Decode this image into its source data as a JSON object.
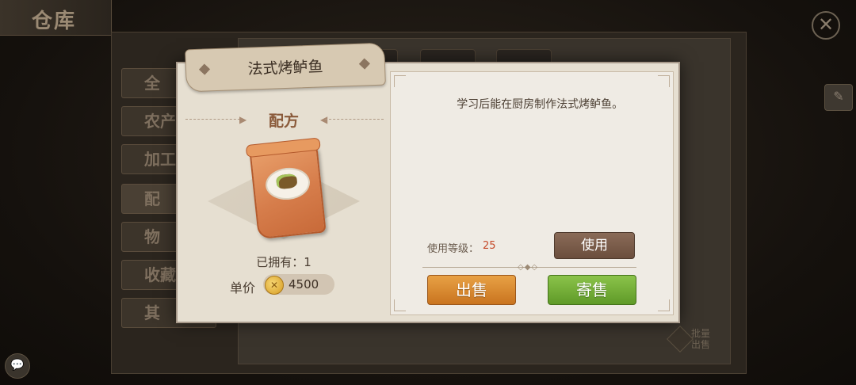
{
  "background": {
    "title": "仓库",
    "tabs": [
      {
        "label": "全"
      },
      {
        "label": "农产"
      },
      {
        "label": "加工"
      },
      {
        "label": "配"
      },
      {
        "label": "物"
      },
      {
        "label": "收藏"
      },
      {
        "label": "其"
      }
    ],
    "batch_sell_label": "批量出售"
  },
  "dialog": {
    "item_name": "法式烤鲈鱼",
    "category": "配方",
    "owned_label": "已拥有：",
    "owned_count": "1",
    "price_label": "单价",
    "price_value": "4500",
    "description": "学习后能在厨房制作法式烤鲈鱼。",
    "level_label": "使用等级：",
    "level_value": "25",
    "use_button": "使用",
    "sell_button": "出售",
    "consign_button": "寄售"
  },
  "colors": {
    "sell": "#d9892f",
    "consign": "#74b03a",
    "level_value": "#c54a2a"
  }
}
